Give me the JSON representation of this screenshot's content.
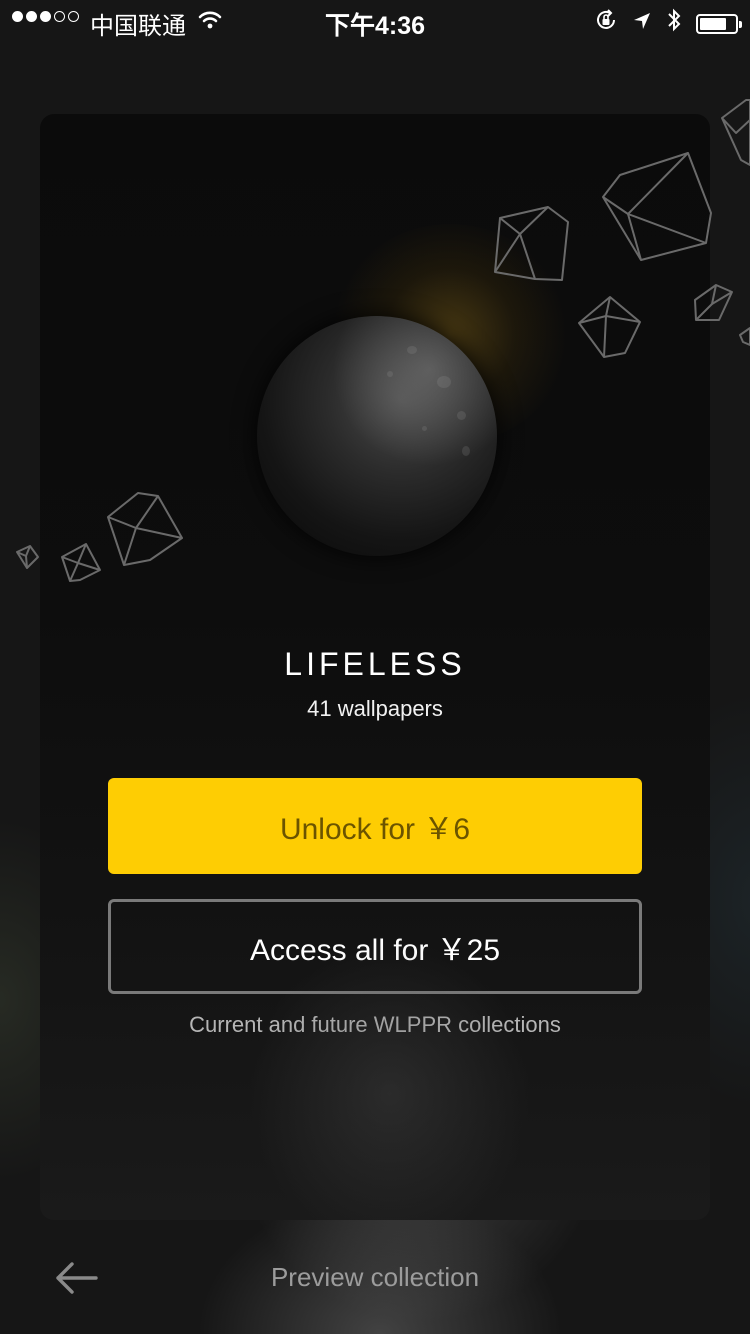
{
  "status_bar": {
    "carrier": "中国联通",
    "time": "下午4:36",
    "signal_bars_filled": 3,
    "signal_bars_total": 5,
    "battery_level": 0.75,
    "icons": [
      "wifi-icon",
      "orientation-lock-icon",
      "location-arrow-icon",
      "bluetooth-icon",
      "battery-icon"
    ]
  },
  "collection": {
    "title": "LIFELESS",
    "count_label": "41 wallpapers"
  },
  "purchase": {
    "unlock_label": "Unlock for  ￥6",
    "access_all_label": "Access all for  ￥25",
    "access_all_note": "Current and future WLPPR collections"
  },
  "footer": {
    "back_icon": "arrow-left-icon",
    "preview_label": "Preview collection"
  },
  "colors": {
    "accent": "#fecd03",
    "background": "#161616"
  }
}
